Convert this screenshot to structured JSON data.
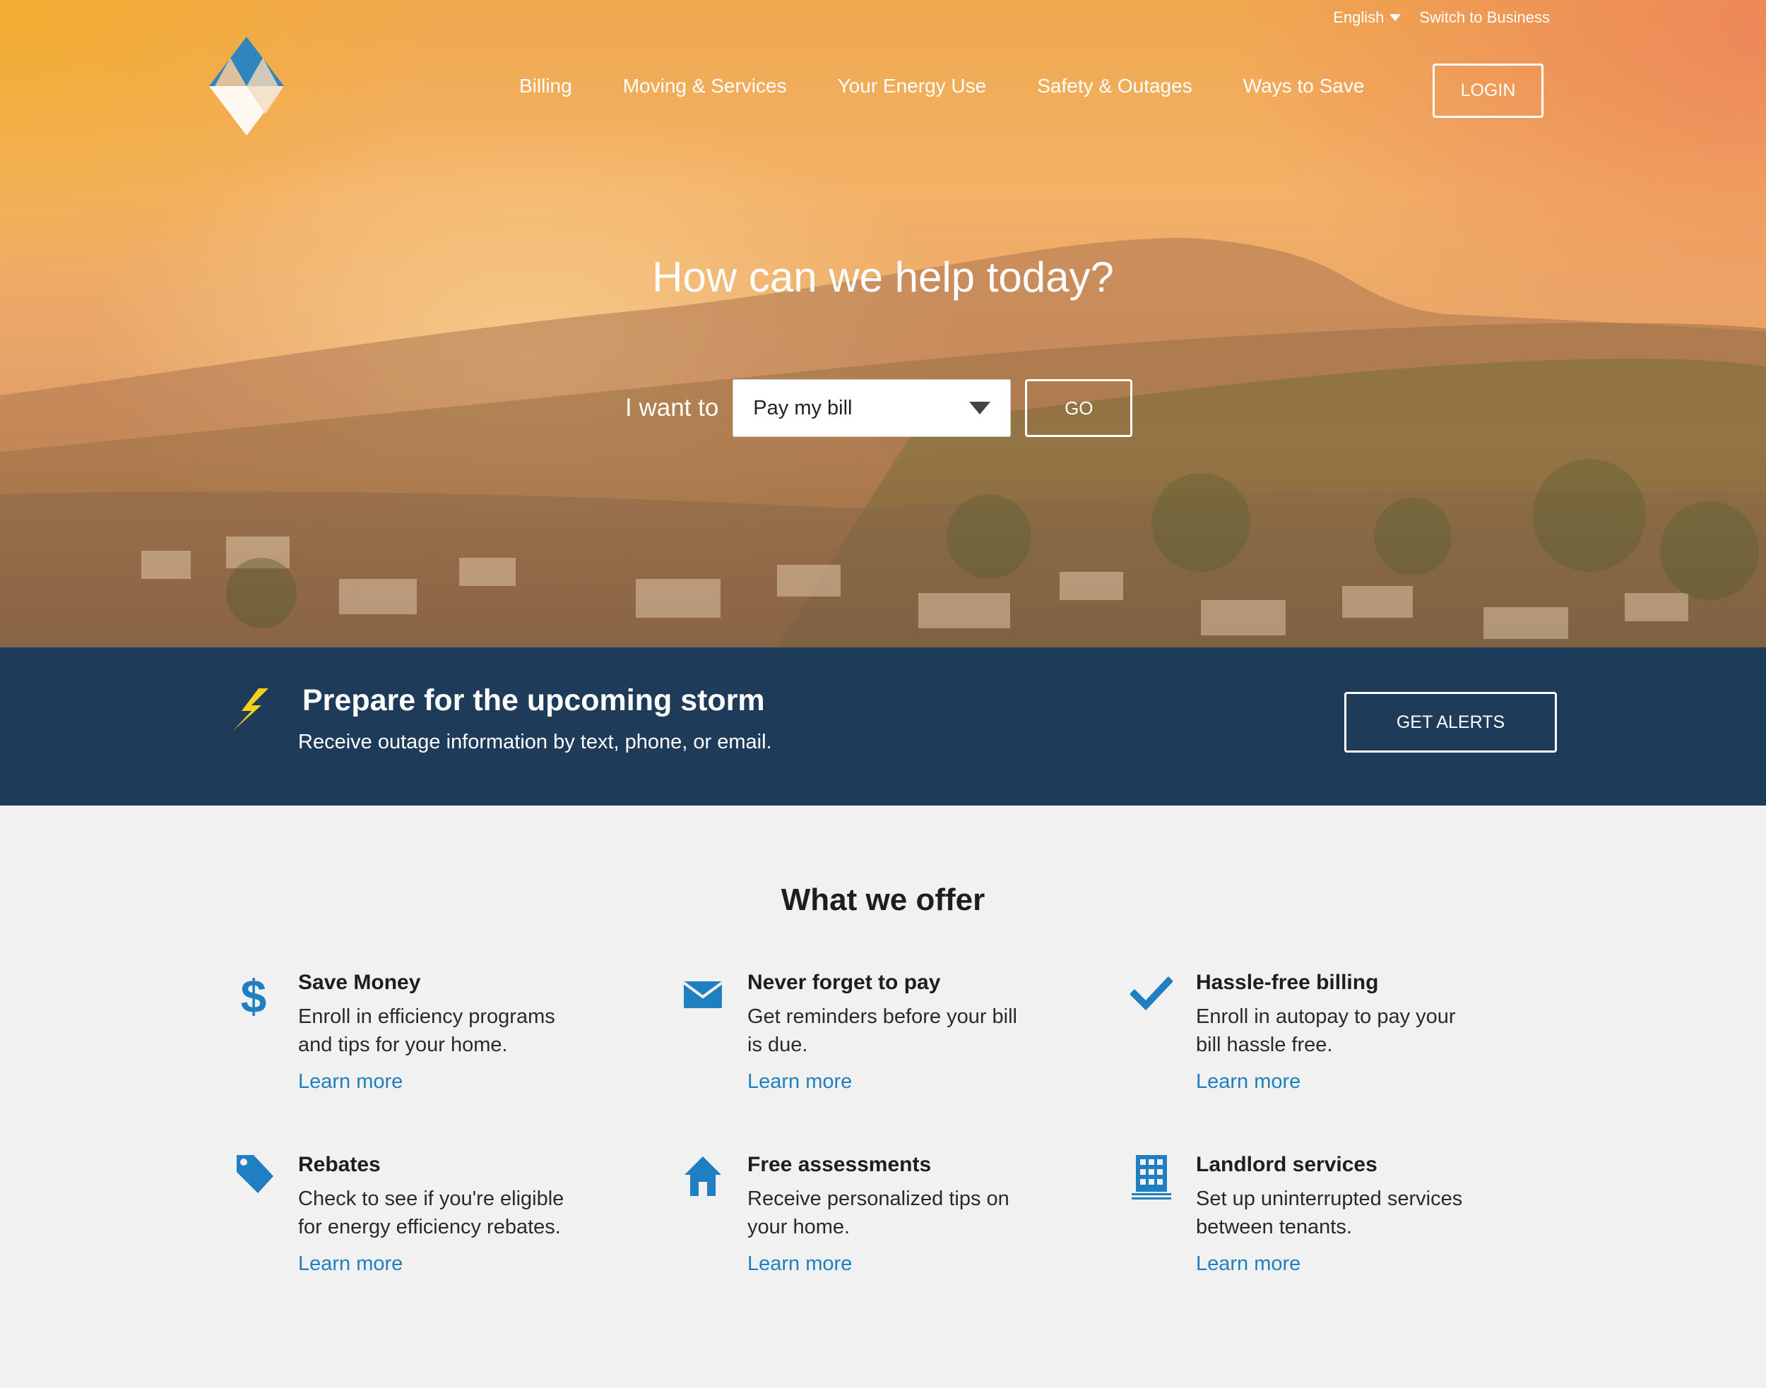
{
  "util": {
    "language": "English",
    "switch_label": "Switch to Business"
  },
  "nav": {
    "items": [
      "Billing",
      "Moving & Services",
      "Your Energy Use",
      "Safety & Outages",
      "Ways to Save"
    ],
    "login_label": "LOGIN"
  },
  "hero": {
    "title": "How can we help today?",
    "want_label": "I want to",
    "select_value": "Pay my bill",
    "go_label": "GO"
  },
  "alert": {
    "title": "Prepare for the upcoming storm",
    "subtitle": "Receive outage information by text, phone, or email.",
    "button_label": "GET ALERTS"
  },
  "offers": {
    "title": "What we offer",
    "items": [
      {
        "icon": "dollar-icon",
        "title": "Save Money",
        "text": "Enroll in efficiency programs and tips for your home.",
        "link": "Learn more"
      },
      {
        "icon": "envelope-icon",
        "title": "Never forget to pay",
        "text": "Get reminders before your bill is due.",
        "link": "Learn more"
      },
      {
        "icon": "checkmark-icon",
        "title": "Hassle-free billing",
        "text": "Enroll in autopay to pay your bill hassle free.",
        "link": "Learn more"
      },
      {
        "icon": "price-tag-icon",
        "title": "Rebates",
        "text": "Check to see if you're eligible for energy efficiency rebates.",
        "link": "Learn more"
      },
      {
        "icon": "house-icon",
        "title": "Free assessments",
        "text": "Receive personalized tips on your home.",
        "link": "Learn more"
      },
      {
        "icon": "building-icon",
        "title": "Landlord services",
        "text": "Set up uninterrupted services between tenants.",
        "link": "Learn more"
      }
    ]
  },
  "colors": {
    "alert_band": "#1f3b5a",
    "accent_blue": "#1f7fc0",
    "bolt_yellow": "#f2d21a",
    "page_bg": "#f1f1f1"
  }
}
